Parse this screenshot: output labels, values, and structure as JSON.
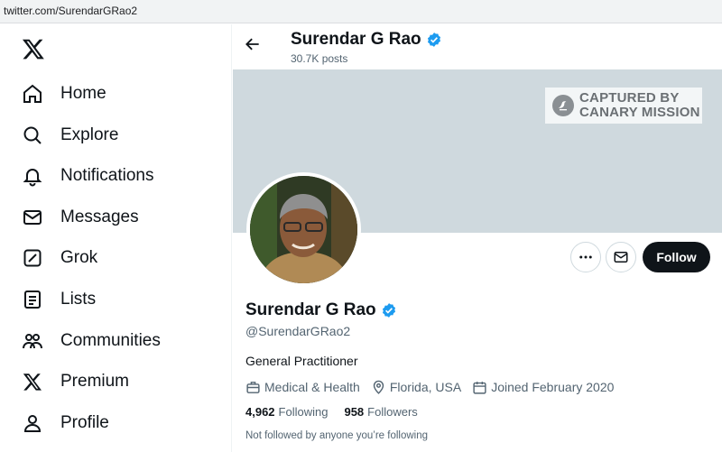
{
  "browser": {
    "url": "twitter.com/SurendarGRao2"
  },
  "sidebar": {
    "items": [
      {
        "label": "Home",
        "icon": "home-icon"
      },
      {
        "label": "Explore",
        "icon": "search-icon"
      },
      {
        "label": "Notifications",
        "icon": "bell-icon"
      },
      {
        "label": "Messages",
        "icon": "envelope-icon"
      },
      {
        "label": "Grok",
        "icon": "grok-icon"
      },
      {
        "label": "Lists",
        "icon": "list-icon"
      },
      {
        "label": "Communities",
        "icon": "people-icon"
      },
      {
        "label": "Premium",
        "icon": "x-logo-icon"
      },
      {
        "label": "Profile",
        "icon": "person-icon"
      }
    ]
  },
  "header": {
    "name": "Surendar G Rao",
    "posts": "30.7K posts"
  },
  "banner": {
    "watermark_line1": "CAPTURED BY",
    "watermark_line2": "CANARY MISSION"
  },
  "actions": {
    "follow_label": "Follow"
  },
  "profile": {
    "name": "Surendar G Rao",
    "handle": "@SurendarGRao2",
    "bio": "General Practitioner",
    "category": "Medical & Health",
    "location": "Florida, USA",
    "joined": "Joined February 2020",
    "following_count": "4,962",
    "following_label": "Following",
    "followers_count": "958",
    "followers_label": "Followers",
    "mutuals_note": "Not followed by anyone you’re following"
  },
  "colors": {
    "verified": "#1d9bf0",
    "banner": "#cfd9de",
    "follow_bg": "#0f1419",
    "muted_text": "#536471"
  }
}
